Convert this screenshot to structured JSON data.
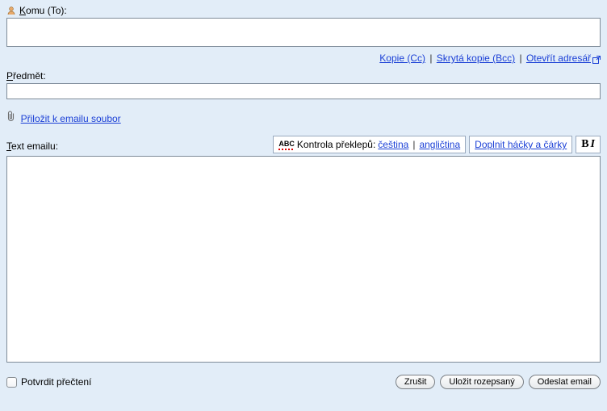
{
  "to": {
    "label_pre": "K",
    "label_rest": "omu (To):",
    "value": ""
  },
  "cc_links": {
    "cc": "Kopie (Cc)",
    "bcc": "Skrytá kopie (Bcc)",
    "addrbook": "Otevřít adresář"
  },
  "subject": {
    "label_pre": "P",
    "label_rest": "ředmět:",
    "value": ""
  },
  "attach": {
    "label": "Přiložit k emailu soubor"
  },
  "body_label": {
    "pre": "T",
    "rest": "ext emailu:"
  },
  "spellcheck": {
    "label": "Kontrola překlepů:",
    "cs": "čeština",
    "en": "angličtina"
  },
  "diacritics": {
    "label": "Doplnit háčky a čárky"
  },
  "body": {
    "value": ""
  },
  "confirm": {
    "label": "Potvrdit přečtení"
  },
  "buttons": {
    "cancel": "Zrušit",
    "save": "Uložit rozepsaný",
    "send": "Odeslat email"
  }
}
